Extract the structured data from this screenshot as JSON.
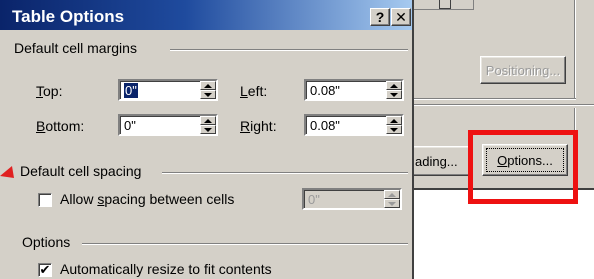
{
  "dialog": {
    "title": "Table Options",
    "help_button": "?",
    "close_button": "✕"
  },
  "margins": {
    "group_label": "Default cell margins",
    "top": {
      "label_u": "T",
      "label_rest": "op:",
      "value": "0\""
    },
    "left": {
      "label_u": "L",
      "label_rest": "eft:",
      "value": "0.08\""
    },
    "bottom": {
      "label_u": "B",
      "label_rest": "ottom:",
      "value": "0\""
    },
    "right": {
      "label_u": "R",
      "label_rest": "ight:",
      "value": "0.08\""
    }
  },
  "spacing": {
    "group_label": "Default cell spacing",
    "allow_checkbox": {
      "label_pre": "Allow ",
      "label_u": "s",
      "label_post": "pacing between cells",
      "checked": false
    },
    "value": "0\""
  },
  "options": {
    "group_label": "Options",
    "auto_resize": {
      "label": "Automatically resize to fit contents",
      "checked": true
    }
  },
  "background": {
    "positioning_button": "Positioning...",
    "shading_button_partial": "ading...",
    "options_button_u": "O",
    "options_button_rest": "ptions..."
  },
  "colors": {
    "title_start": "#0a246a",
    "title_end": "#a6caf0",
    "dialog_face": "#d4d0c8",
    "highlight": "#ee1111"
  }
}
